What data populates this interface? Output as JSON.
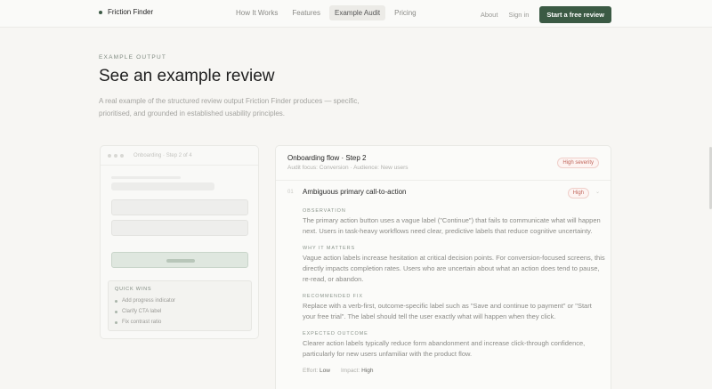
{
  "header": {
    "brand": "Friction Finder",
    "nav": [
      "How It Works",
      "Features",
      "Example Audit",
      "Pricing"
    ],
    "about": "About",
    "signin": "Sign in",
    "cta": "Start a free review"
  },
  "hero": {
    "eyebrow": "EXAMPLE OUTPUT",
    "title": "See an example review",
    "subtitle": "A real example of the structured review output Friction Finder produces — specific, prioritised, and grounded in established usability principles."
  },
  "mock": {
    "step_label": "Onboarding · Step 2 of 4",
    "quick_wins_title": "QUICK WINS",
    "quick_wins": [
      "Add progress indicator",
      "Clarify CTA label",
      "Fix contrast ratio"
    ]
  },
  "review": {
    "title": "Onboarding flow · Step 2",
    "meta": "Audit focus: Conversion · Audience: New users",
    "severity": "High severity",
    "issue": {
      "number": "01",
      "title": "Ambiguous primary call-to-action",
      "badge": "High",
      "observation_label": "OBSERVATION",
      "observation": "The primary action button uses a vague label (\"Continue\") that fails to communicate what will happen next. Users in task-heavy workflows need clear, predictive labels that reduce cognitive uncertainty.",
      "why_label": "WHY IT MATTERS",
      "why": "Vague action labels increase hesitation at critical decision points. For conversion-focused screens, this directly impacts completion rates. Users who are uncertain about what an action does tend to pause, re-read, or abandon.",
      "fix_label": "RECOMMENDED FIX",
      "fix": "Replace with a verb-first, outcome-specific label such as \"Save and continue to payment\" or \"Start your free trial\". The label should tell the user exactly what will happen when they click.",
      "outcome_label": "EXPECTED OUTCOME",
      "outcome": "Clearer action labels typically reduce form abandonment and increase click-through confidence, particularly for new users unfamiliar with the product flow.",
      "effort_label": "Effort:",
      "effort": "Low",
      "impact_label": "Impact:",
      "impact": "High"
    }
  }
}
